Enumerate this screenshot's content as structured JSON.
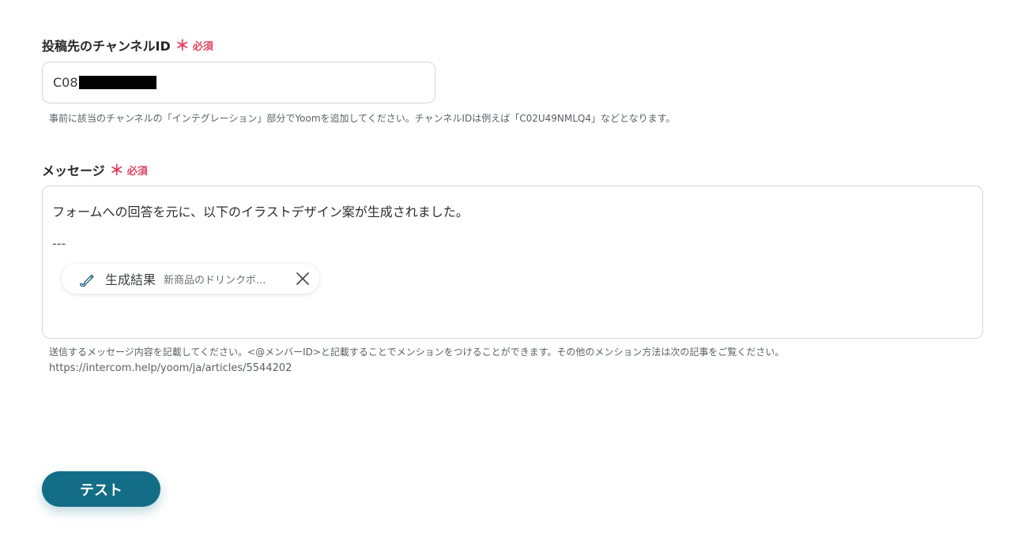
{
  "channel_field": {
    "label": "投稿先のチャンネルID",
    "required_star": "＊",
    "required_text": "必須",
    "value_visible": "C08",
    "help": "事前に該当のチャンネルの「インテグレーション」部分でYoomを追加してください。チャンネルIDは例えば「C02U49NMLQ4」などとなります。"
  },
  "message_field": {
    "label": "メッセージ",
    "required_star": "＊",
    "required_text": "必須",
    "line1": "フォームへの回答を元に、以下のイラストデザイン案が生成されました。",
    "line2": "---",
    "chip": {
      "icon": "pen-icon",
      "label": "生成結果",
      "value": "新商品のドリンクボ..."
    },
    "help_line1": "送信するメッセージ内容を記載してください。<@メンバーID>と記載することでメンションをつけることができます。その他のメンション方法は次の記事をご覧ください。",
    "help_line2": "https://intercom.help/yoom/ja/articles/5544202"
  },
  "test_button": {
    "label": "テスト"
  },
  "colors": {
    "required": "#e2435f",
    "button": "#136d86",
    "border": "#d3d6da"
  }
}
